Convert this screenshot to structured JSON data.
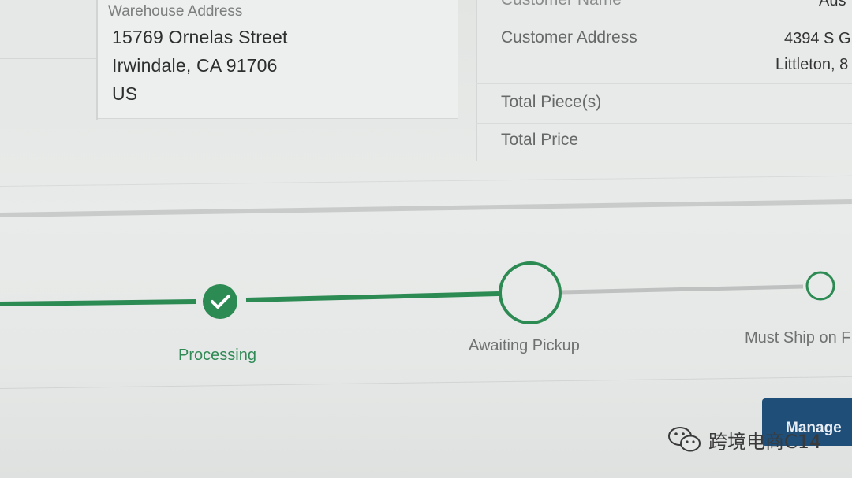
{
  "warehouse": {
    "label": "Warehouse Address",
    "line1": "15769 Ornelas Street",
    "line2": "Irwindale, CA 91706",
    "line3": "US"
  },
  "customer": {
    "name_label": "Customer Name",
    "name_value": "Aus",
    "address_label": "Customer Address",
    "address_line1": "4394 S G",
    "address_line2": "Littleton, 8",
    "pieces_label": "Total Piece(s)",
    "price_label": "Total Price"
  },
  "tracker": {
    "steps": [
      {
        "label": "Processing",
        "state": "complete"
      },
      {
        "label": "Awaiting Pickup",
        "state": "current"
      },
      {
        "label": "Must Ship on F",
        "state": "upcoming"
      }
    ],
    "colors": {
      "complete": "#2c8a53",
      "upcoming": "#bfc1c0"
    }
  },
  "actions": {
    "manage_label": "Manage"
  },
  "watermark": {
    "text": "跨境电商C14"
  }
}
